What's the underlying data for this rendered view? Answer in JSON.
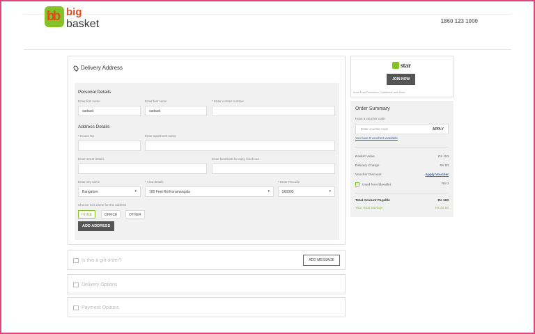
{
  "header": {
    "logo_big": "big",
    "logo_basket": "basket",
    "phone": "1860 123 1000"
  },
  "delivery": {
    "title": "Delivery Address",
    "personal_title": "Personal Details",
    "first_name_label": "Enter first name",
    "first_name_value": "sadasd",
    "last_name_label": "Enter last name",
    "last_name_value": "sadasd",
    "contact_label": "* Enter contact number",
    "contact_value": "",
    "address_title": "Address Details",
    "house_label": "* House No",
    "apartment_label": "Enter apartment name",
    "street_label": "Enter street details",
    "landmark_label": "Enter landmark for easy reach out",
    "city_label": "Enter city name",
    "city_value": "Bangalore",
    "area_label": "* Area details",
    "area_value": "100 Feet Rd-Koramangala",
    "pincode_label": "* Enter Pincode",
    "pincode_value": "560095",
    "nickname_label": "Choose nick name for this address",
    "chips": [
      "HOME",
      "OFFICE",
      "OTHER"
    ],
    "add_address": "ADD ADDRESS"
  },
  "gift": {
    "title": "Is this a gift order?",
    "button": "ADD MESSAGE"
  },
  "delivery_options": {
    "title": "Delivery Options"
  },
  "payment_options": {
    "title": "Payment Options"
  },
  "bbstar": {
    "logo": "star",
    "join": "JOIN NOW",
    "note": "Avail Free Deliveries, Cashback and More"
  },
  "summary": {
    "title": "Order Summary",
    "have_voucher": "Have a voucher code",
    "voucher_placeholder": "Enter voucher code",
    "apply": "APPLY",
    "vouchers_link": "You have 8 vouchers available",
    "basket_label": "Basket Value",
    "basket_value": "Rs 110",
    "delivery_label": "Delivery Charge",
    "delivery_value": "Rs 50",
    "discount_label": "Voucher Discount",
    "discount_value": "Apply Voucher",
    "wallet_label": "Used from bbwallet",
    "wallet_value": "Rs 0",
    "total_label": "Total Amount Payable",
    "total_value": "Rs 160",
    "savings_label": "Your Total Savings",
    "savings_value": "Rs 22.50"
  }
}
